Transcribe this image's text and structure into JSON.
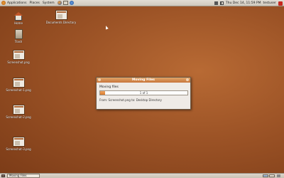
{
  "top_panel": {
    "menus": [
      "Applications",
      "Places",
      "System"
    ],
    "clock": "Thu Dec 14, 11:59 PM",
    "user": "testuser"
  },
  "desktop": {
    "icons": [
      {
        "label": "Home",
        "type": "home"
      },
      {
        "label": "Trash",
        "type": "trash"
      },
      {
        "label": "Screenshot.png",
        "type": "image"
      },
      {
        "label": "Screenshot-1.png",
        "type": "image"
      },
      {
        "label": "Screenshot-2.png",
        "type": "image"
      },
      {
        "label": "Screenshot-3.png",
        "type": "image"
      },
      {
        "label": "Documents Directory",
        "type": "image"
      }
    ]
  },
  "dialog": {
    "title": "Moving Files",
    "heading": "Moving files",
    "progress_text": "1 of 1",
    "progress_fraction": 0.06,
    "detail": "From: Screenshot.png to: Desktop Directory"
  },
  "bottom_panel": {
    "task_label": "Moving Files"
  },
  "colors": {
    "wallpaper": "#9c5326",
    "accent": "#d87a2e"
  }
}
